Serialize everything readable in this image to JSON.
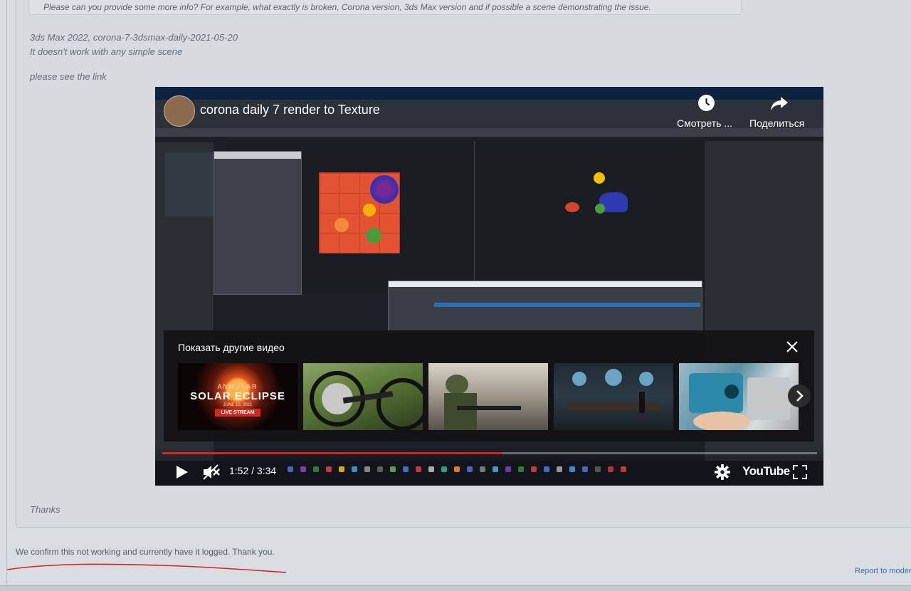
{
  "quote": {
    "text": "Please can you provide some more info? For example, what exactly is broken, Corona version, 3ds Max version and if possible a scene demonstrating the issue."
  },
  "post": {
    "line1": "3ds Max 2022, corona-7-3dsmax-daily-2021-05-20",
    "line2": "It doesn't work with any simple scene",
    "line3": "please see the link",
    "thanks": "Thanks"
  },
  "video": {
    "title": "corona daily 7 render to Texture",
    "watch_later_label": "Смотреть ...",
    "share_label": "Поделиться",
    "more_videos_title": "Показать другие видео",
    "time_display": "1:52 / 3:34",
    "progress_fraction": 0.52,
    "logo": "YouTube",
    "thumbnails": [
      {
        "name": "solar-eclipse",
        "line1": "ANNULAR",
        "line2": "SOLAR ECLIPSE",
        "line3": "JUNE 10, 2021",
        "badge": "LIVE STREAM"
      },
      {
        "name": "bicycle"
      },
      {
        "name": "soldier"
      },
      {
        "name": "meeting-room"
      },
      {
        "name": "device"
      }
    ]
  },
  "reply": {
    "text": "We confirm this not working and currently have it logged. Thank you.",
    "report_link": "Report to moder"
  },
  "colors": {
    "background": "#d9dde2",
    "link": "#3e6aa6",
    "progress": "#e0221d",
    "annotation": "#d2232a"
  }
}
